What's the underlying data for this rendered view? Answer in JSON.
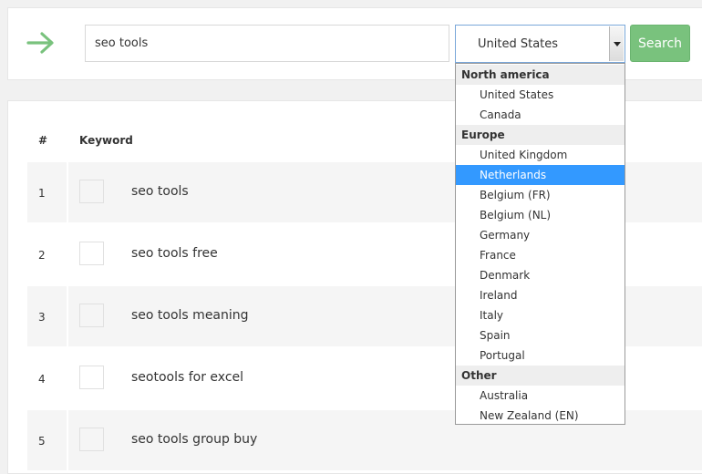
{
  "search": {
    "query": "seo tools",
    "country_selected": "United States",
    "button_label": "Search"
  },
  "table": {
    "headers": {
      "num": "#",
      "keyword": "Keyword"
    },
    "rows": [
      {
        "num": "1",
        "keyword": "seo tools"
      },
      {
        "num": "2",
        "keyword": "seo tools free"
      },
      {
        "num": "3",
        "keyword": "seo tools meaning"
      },
      {
        "num": "4",
        "keyword": "seotools for excel"
      },
      {
        "num": "5",
        "keyword": "seo tools group buy"
      }
    ]
  },
  "dropdown": {
    "highlighted": "Netherlands",
    "groups": [
      {
        "label": "North america",
        "options": [
          "United States",
          "Canada"
        ]
      },
      {
        "label": "Europe",
        "options": [
          "United Kingdom",
          "Netherlands",
          "Belgium (FR)",
          "Belgium (NL)",
          "Germany",
          "France",
          "Denmark",
          "Ireland",
          "Italy",
          "Spain",
          "Portugal"
        ]
      },
      {
        "label": "Other",
        "options": [
          "Australia",
          "New Zealand (EN)"
        ]
      }
    ]
  },
  "colors": {
    "accent_green": "#79c27d",
    "highlight_blue": "#3399ff"
  },
  "icons": {
    "go": "arrow-right-icon",
    "select": "chevron-down-icon"
  }
}
